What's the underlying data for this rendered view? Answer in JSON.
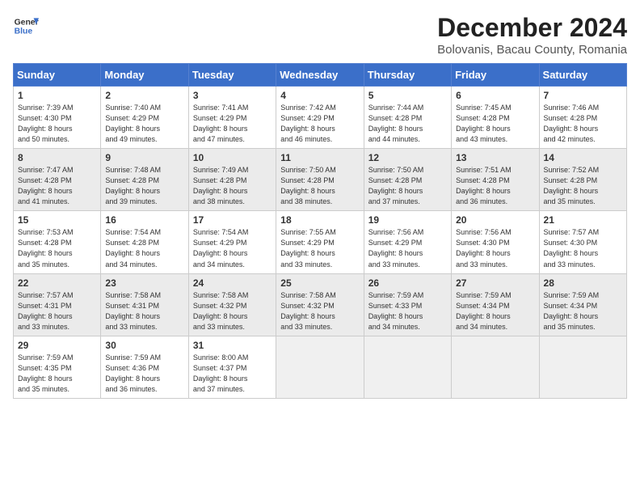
{
  "header": {
    "logo_line1": "General",
    "logo_line2": "Blue",
    "title": "December 2024",
    "subtitle": "Bolovanis, Bacau County, Romania"
  },
  "days_of_week": [
    "Sunday",
    "Monday",
    "Tuesday",
    "Wednesday",
    "Thursday",
    "Friday",
    "Saturday"
  ],
  "weeks": [
    [
      {
        "day": "1",
        "info": "Sunrise: 7:39 AM\nSunset: 4:30 PM\nDaylight: 8 hours\nand 50 minutes."
      },
      {
        "day": "2",
        "info": "Sunrise: 7:40 AM\nSunset: 4:29 PM\nDaylight: 8 hours\nand 49 minutes."
      },
      {
        "day": "3",
        "info": "Sunrise: 7:41 AM\nSunset: 4:29 PM\nDaylight: 8 hours\nand 47 minutes."
      },
      {
        "day": "4",
        "info": "Sunrise: 7:42 AM\nSunset: 4:29 PM\nDaylight: 8 hours\nand 46 minutes."
      },
      {
        "day": "5",
        "info": "Sunrise: 7:44 AM\nSunset: 4:28 PM\nDaylight: 8 hours\nand 44 minutes."
      },
      {
        "day": "6",
        "info": "Sunrise: 7:45 AM\nSunset: 4:28 PM\nDaylight: 8 hours\nand 43 minutes."
      },
      {
        "day": "7",
        "info": "Sunrise: 7:46 AM\nSunset: 4:28 PM\nDaylight: 8 hours\nand 42 minutes."
      }
    ],
    [
      {
        "day": "8",
        "info": "Sunrise: 7:47 AM\nSunset: 4:28 PM\nDaylight: 8 hours\nand 41 minutes."
      },
      {
        "day": "9",
        "info": "Sunrise: 7:48 AM\nSunset: 4:28 PM\nDaylight: 8 hours\nand 39 minutes."
      },
      {
        "day": "10",
        "info": "Sunrise: 7:49 AM\nSunset: 4:28 PM\nDaylight: 8 hours\nand 38 minutes."
      },
      {
        "day": "11",
        "info": "Sunrise: 7:50 AM\nSunset: 4:28 PM\nDaylight: 8 hours\nand 38 minutes."
      },
      {
        "day": "12",
        "info": "Sunrise: 7:50 AM\nSunset: 4:28 PM\nDaylight: 8 hours\nand 37 minutes."
      },
      {
        "day": "13",
        "info": "Sunrise: 7:51 AM\nSunset: 4:28 PM\nDaylight: 8 hours\nand 36 minutes."
      },
      {
        "day": "14",
        "info": "Sunrise: 7:52 AM\nSunset: 4:28 PM\nDaylight: 8 hours\nand 35 minutes."
      }
    ],
    [
      {
        "day": "15",
        "info": "Sunrise: 7:53 AM\nSunset: 4:28 PM\nDaylight: 8 hours\nand 35 minutes."
      },
      {
        "day": "16",
        "info": "Sunrise: 7:54 AM\nSunset: 4:28 PM\nDaylight: 8 hours\nand 34 minutes."
      },
      {
        "day": "17",
        "info": "Sunrise: 7:54 AM\nSunset: 4:29 PM\nDaylight: 8 hours\nand 34 minutes."
      },
      {
        "day": "18",
        "info": "Sunrise: 7:55 AM\nSunset: 4:29 PM\nDaylight: 8 hours\nand 33 minutes."
      },
      {
        "day": "19",
        "info": "Sunrise: 7:56 AM\nSunset: 4:29 PM\nDaylight: 8 hours\nand 33 minutes."
      },
      {
        "day": "20",
        "info": "Sunrise: 7:56 AM\nSunset: 4:30 PM\nDaylight: 8 hours\nand 33 minutes."
      },
      {
        "day": "21",
        "info": "Sunrise: 7:57 AM\nSunset: 4:30 PM\nDaylight: 8 hours\nand 33 minutes."
      }
    ],
    [
      {
        "day": "22",
        "info": "Sunrise: 7:57 AM\nSunset: 4:31 PM\nDaylight: 8 hours\nand 33 minutes."
      },
      {
        "day": "23",
        "info": "Sunrise: 7:58 AM\nSunset: 4:31 PM\nDaylight: 8 hours\nand 33 minutes."
      },
      {
        "day": "24",
        "info": "Sunrise: 7:58 AM\nSunset: 4:32 PM\nDaylight: 8 hours\nand 33 minutes."
      },
      {
        "day": "25",
        "info": "Sunrise: 7:58 AM\nSunset: 4:32 PM\nDaylight: 8 hours\nand 33 minutes."
      },
      {
        "day": "26",
        "info": "Sunrise: 7:59 AM\nSunset: 4:33 PM\nDaylight: 8 hours\nand 34 minutes."
      },
      {
        "day": "27",
        "info": "Sunrise: 7:59 AM\nSunset: 4:34 PM\nDaylight: 8 hours\nand 34 minutes."
      },
      {
        "day": "28",
        "info": "Sunrise: 7:59 AM\nSunset: 4:34 PM\nDaylight: 8 hours\nand 35 minutes."
      }
    ],
    [
      {
        "day": "29",
        "info": "Sunrise: 7:59 AM\nSunset: 4:35 PM\nDaylight: 8 hours\nand 35 minutes."
      },
      {
        "day": "30",
        "info": "Sunrise: 7:59 AM\nSunset: 4:36 PM\nDaylight: 8 hours\nand 36 minutes."
      },
      {
        "day": "31",
        "info": "Sunrise: 8:00 AM\nSunset: 4:37 PM\nDaylight: 8 hours\nand 37 minutes."
      },
      {
        "day": "",
        "info": ""
      },
      {
        "day": "",
        "info": ""
      },
      {
        "day": "",
        "info": ""
      },
      {
        "day": "",
        "info": ""
      }
    ]
  ]
}
